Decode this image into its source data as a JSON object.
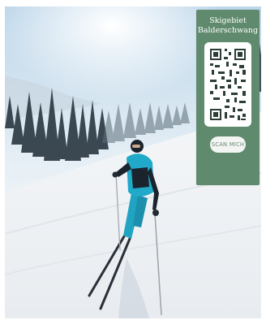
{
  "qr_panel": {
    "title_line1": "Skigebiet",
    "title_line2": "Balderschwang",
    "button_label": "SCAN MICH",
    "background_color": "#5f8a6d"
  },
  "photo": {
    "icon": "skier-photo"
  }
}
